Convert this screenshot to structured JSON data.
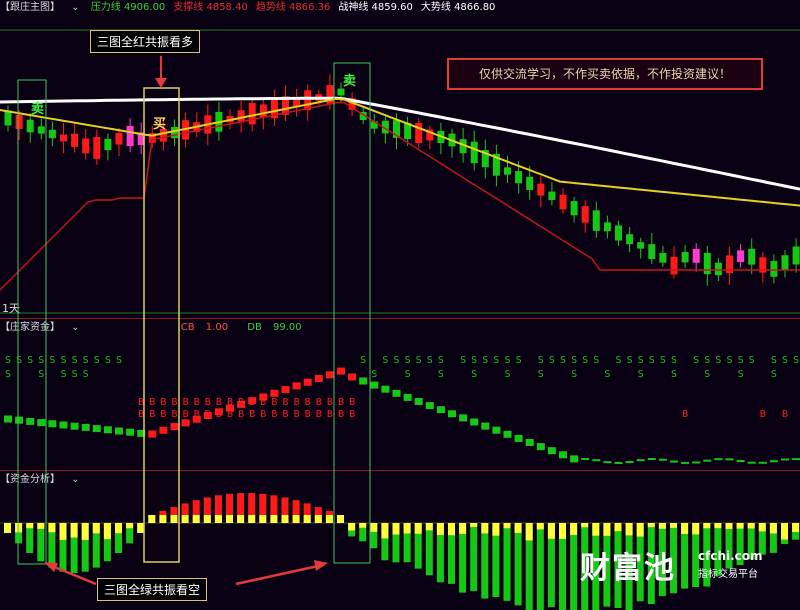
{
  "panel1": {
    "title": "【跟庄主图】",
    "indicators": [
      {
        "label": "压力线",
        "value": "4906.00",
        "color": "#35d235"
      },
      {
        "label": "支撑线",
        "value": "4858.40",
        "color": "#e03030"
      },
      {
        "label": "趋势线",
        "value": "4866.36",
        "color": "#e03030"
      },
      {
        "label": "战神线",
        "value": "4859.60",
        "color": "#ffffff"
      },
      {
        "label": "大势线",
        "value": "4866.80",
        "color": "#ffffff"
      }
    ],
    "period": "1天",
    "buy_marker": "买",
    "sell_markers": [
      "卖",
      "卖"
    ]
  },
  "panel2": {
    "title": "【庄家资金】",
    "cb_label": "CB",
    "cb_value": "1.00",
    "db_label": "DB",
    "db_value": "99.00",
    "s_glyph": "S",
    "b_glyph": "B"
  },
  "panel3": {
    "title": "【资金分析】"
  },
  "annotations": {
    "top_note": "三图全红共振看多",
    "bottom_note": "三图全绿共振看空",
    "disclaimer": "仅供交流学习，不作买卖依据，不作投资建议！"
  },
  "watermark": {
    "brand": "财富池",
    "domain": "cfchi.com",
    "tagline": "指标交易平台"
  },
  "colors": {
    "up": "#ff1a1a",
    "down": "#14c814",
    "neutral": "#ff3ccf",
    "ma_white": "#ffffff",
    "ma_yellow": "#e6d21e",
    "ma_red": "#c01818",
    "histo_yellow": "#ffff3a",
    "grid": "#1d7a1d"
  }
}
